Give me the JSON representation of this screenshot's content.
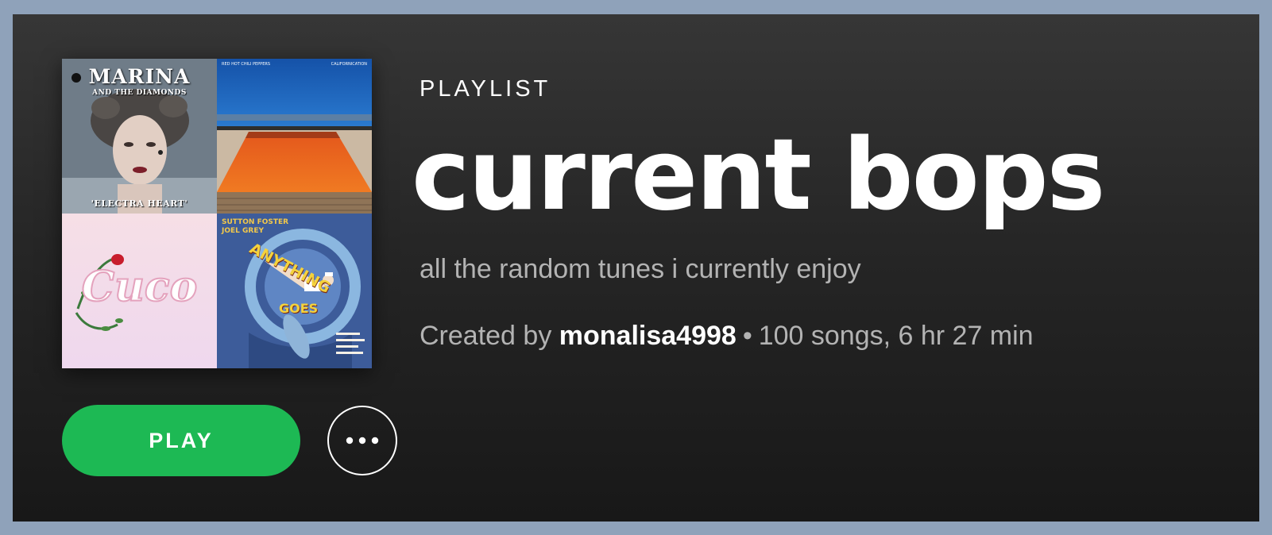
{
  "playlist": {
    "type_label": "PLAYLIST",
    "title": "current bops",
    "description": "all the random tunes i currently enjoy",
    "created_by_prefix": "Created by",
    "owner": "monalisa4998",
    "separator": "•",
    "stats": "100 songs, 6 hr 27 min"
  },
  "cover": {
    "tiles": [
      {
        "title": "MARINA",
        "subtitle": "AND THE DIAMONDS",
        "footer": "'ELECTRA HEART'"
      },
      {
        "top_left": "RED HOT CHILI PEPPERS",
        "top_right": "CALIFORNICATION"
      },
      {
        "word": "Cuco"
      },
      {
        "line1": "SUTTON FOSTER",
        "line2": "JOEL GREY",
        "word1": "ANYTHING",
        "word2": "GOES"
      }
    ]
  },
  "actions": {
    "play_label": "PLAY",
    "more_icon": "ellipsis-icon"
  },
  "colors": {
    "accent_green": "#1db954",
    "text_primary": "#ffffff",
    "text_secondary": "#b3b3b3",
    "outer_bg": "#8fa2ba"
  }
}
